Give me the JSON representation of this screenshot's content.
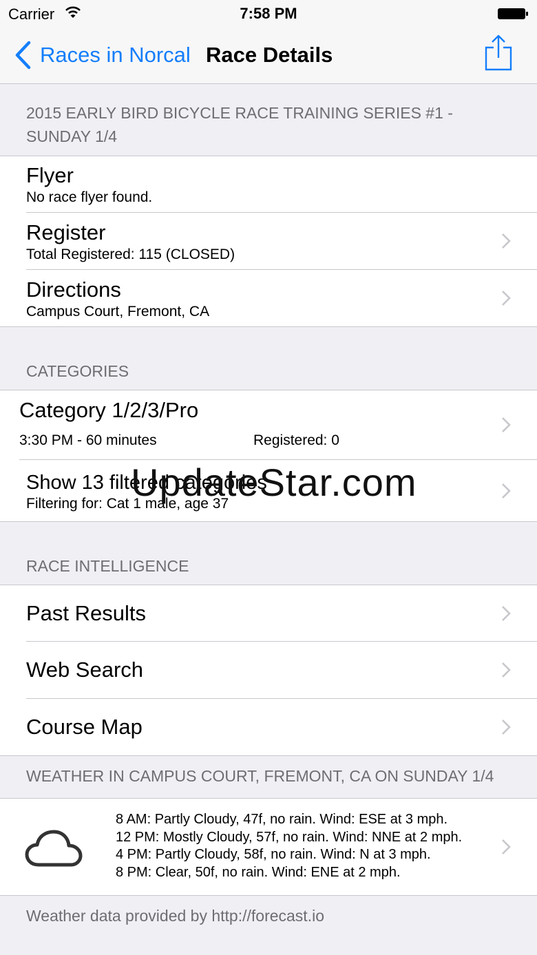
{
  "status_bar": {
    "carrier": "Carrier",
    "time": "7:58 PM"
  },
  "nav": {
    "back_label": "Races in Norcal",
    "title": "Race Details"
  },
  "race": {
    "header": "2015 EARLY BIRD BICYCLE RACE TRAINING SERIES #1 - SUNDAY 1/4",
    "flyer": {
      "title": "Flyer",
      "subtitle": "No race flyer found."
    },
    "register": {
      "title": "Register",
      "subtitle": "Total Registered: 115 (CLOSED)"
    },
    "directions": {
      "title": "Directions",
      "subtitle": "Campus Court, Fremont, CA"
    }
  },
  "categories": {
    "header": "CATEGORIES",
    "item": {
      "title": "Category 1/2/3/Pro",
      "time": "3:30 PM - 60 minutes",
      "registered": "Registered: 0"
    },
    "filtered": {
      "title": "Show 13 filtered categories",
      "subtitle": "Filtering for: Cat 1 male, age 37"
    }
  },
  "intelligence": {
    "header": "RACE INTELLIGENCE",
    "items": [
      "Past Results",
      "Web Search",
      "Course Map"
    ]
  },
  "weather": {
    "header": "WEATHER IN CAMPUS COURT, FREMONT, CA ON SUNDAY 1/4",
    "lines": [
      "8 AM: Partly Cloudy, 47f, no rain. Wind: ESE at 3 mph.",
      "12 PM: Mostly Cloudy, 57f, no rain. Wind: NNE at 2 mph.",
      "4 PM: Partly Cloudy, 58f, no rain. Wind: N at 3 mph.",
      "8 PM: Clear, 50f, no rain. Wind: ENE at 2 mph."
    ],
    "footer": "Weather data provided by http://forecast.io"
  },
  "watermark": "UpdateStar.com",
  "colors": {
    "accent": "#147efb",
    "background": "#efeff4",
    "separator": "#c8c7cc"
  }
}
